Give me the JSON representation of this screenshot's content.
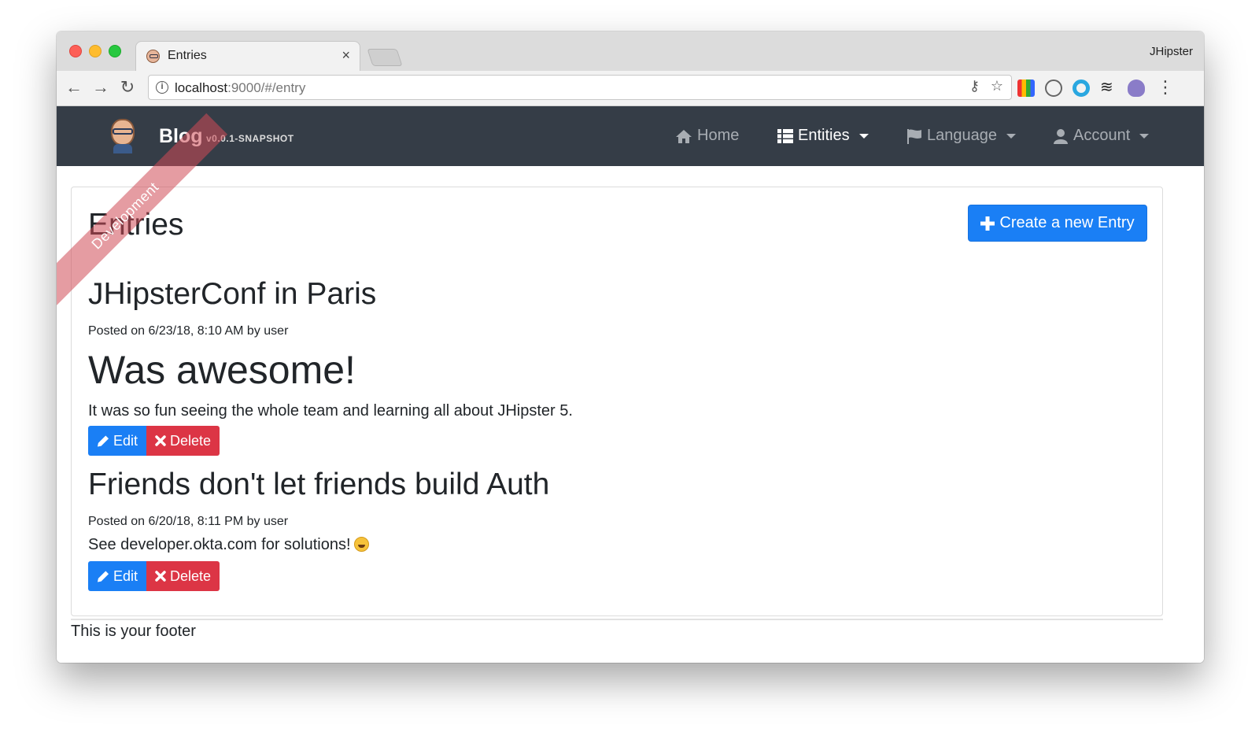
{
  "browser": {
    "tab_title": "Entries",
    "profile_name": "JHipster",
    "url_host": "localhost",
    "url_path": ":9000/#/entry"
  },
  "navbar": {
    "brand": "Blog",
    "version": "v0.0.1-SNAPSHOT",
    "ribbon": "Development",
    "items": [
      {
        "label": "Home",
        "icon": "home-icon"
      },
      {
        "label": "Entities",
        "icon": "th-list-icon"
      },
      {
        "label": "Language",
        "icon": "flag-icon"
      },
      {
        "label": "Account",
        "icon": "user-icon"
      }
    ]
  },
  "page": {
    "heading": "Entries",
    "create_button": "Create a new Entry"
  },
  "entries": [
    {
      "title": "JHipsterConf in Paris",
      "meta": "Posted on 6/23/18, 8:10 AM by user",
      "heading": "Was awesome!",
      "text": "It was so fun seeing the whole team and learning all about JHipster 5.",
      "edit": "Edit",
      "delete": "Delete"
    },
    {
      "title": "Friends don't let friends build Auth",
      "meta": "Posted on 6/20/18, 8:11 PM by user",
      "text": "See developer.okta.com for solutions!",
      "edit": "Edit",
      "delete": "Delete"
    }
  ],
  "footer": "This is your footer",
  "colors": {
    "navbar_bg": "#353d47",
    "primary": "#1a7ff5",
    "danger": "#dc3545",
    "ribbon": "#d04a56"
  }
}
